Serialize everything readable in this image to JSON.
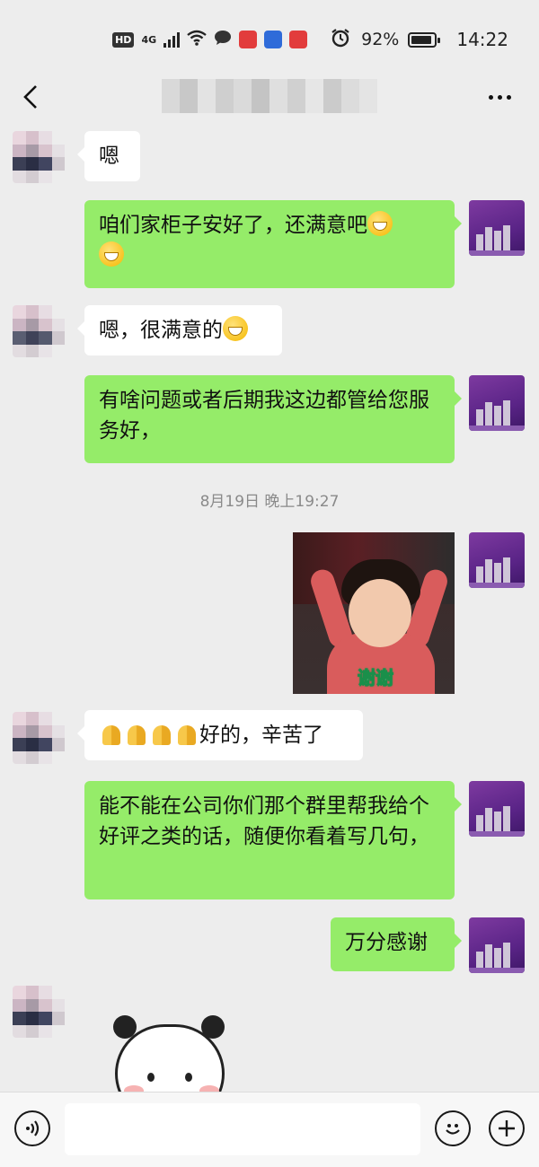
{
  "status_bar": {
    "hd_label": "HD",
    "network_label": "4G",
    "battery_percent": "92%",
    "battery_level": 0.92,
    "time": "14:22"
  },
  "header": {
    "title_visible": false
  },
  "messages": [
    {
      "side": "left",
      "text": "嗯"
    },
    {
      "side": "right",
      "text": "咱们家柜子安好了，还满意吧",
      "emoji_after": "grinning-face-icon",
      "second_line_emoji": "grinning-face-icon"
    },
    {
      "side": "left",
      "text": "嗯，很满意的",
      "emoji_after": "money-face-icon"
    },
    {
      "side": "right",
      "text": "有啥问题或者后期我这边都管给您服务好，"
    },
    {
      "side": "right",
      "type": "image",
      "caption": "谢谢"
    },
    {
      "side": "left",
      "prefix_emoji_count": 4,
      "prefix_emoji": "folded-hands-icon",
      "text": "好的，辛苦了"
    },
    {
      "side": "right",
      "text": "能不能在公司你们那个群里帮我给个好评之类的话，随便你看着写几句，"
    },
    {
      "side": "right",
      "text": "万分感谢"
    },
    {
      "side": "left",
      "type": "sticker",
      "sticker": "panda-sticker"
    }
  ],
  "timestamp": "8月19日 晚上19:27",
  "input_bar": {
    "placeholder": ""
  },
  "colors": {
    "background": "#ededed",
    "bubble_right": "#95ec69",
    "bubble_left": "#ffffff"
  }
}
